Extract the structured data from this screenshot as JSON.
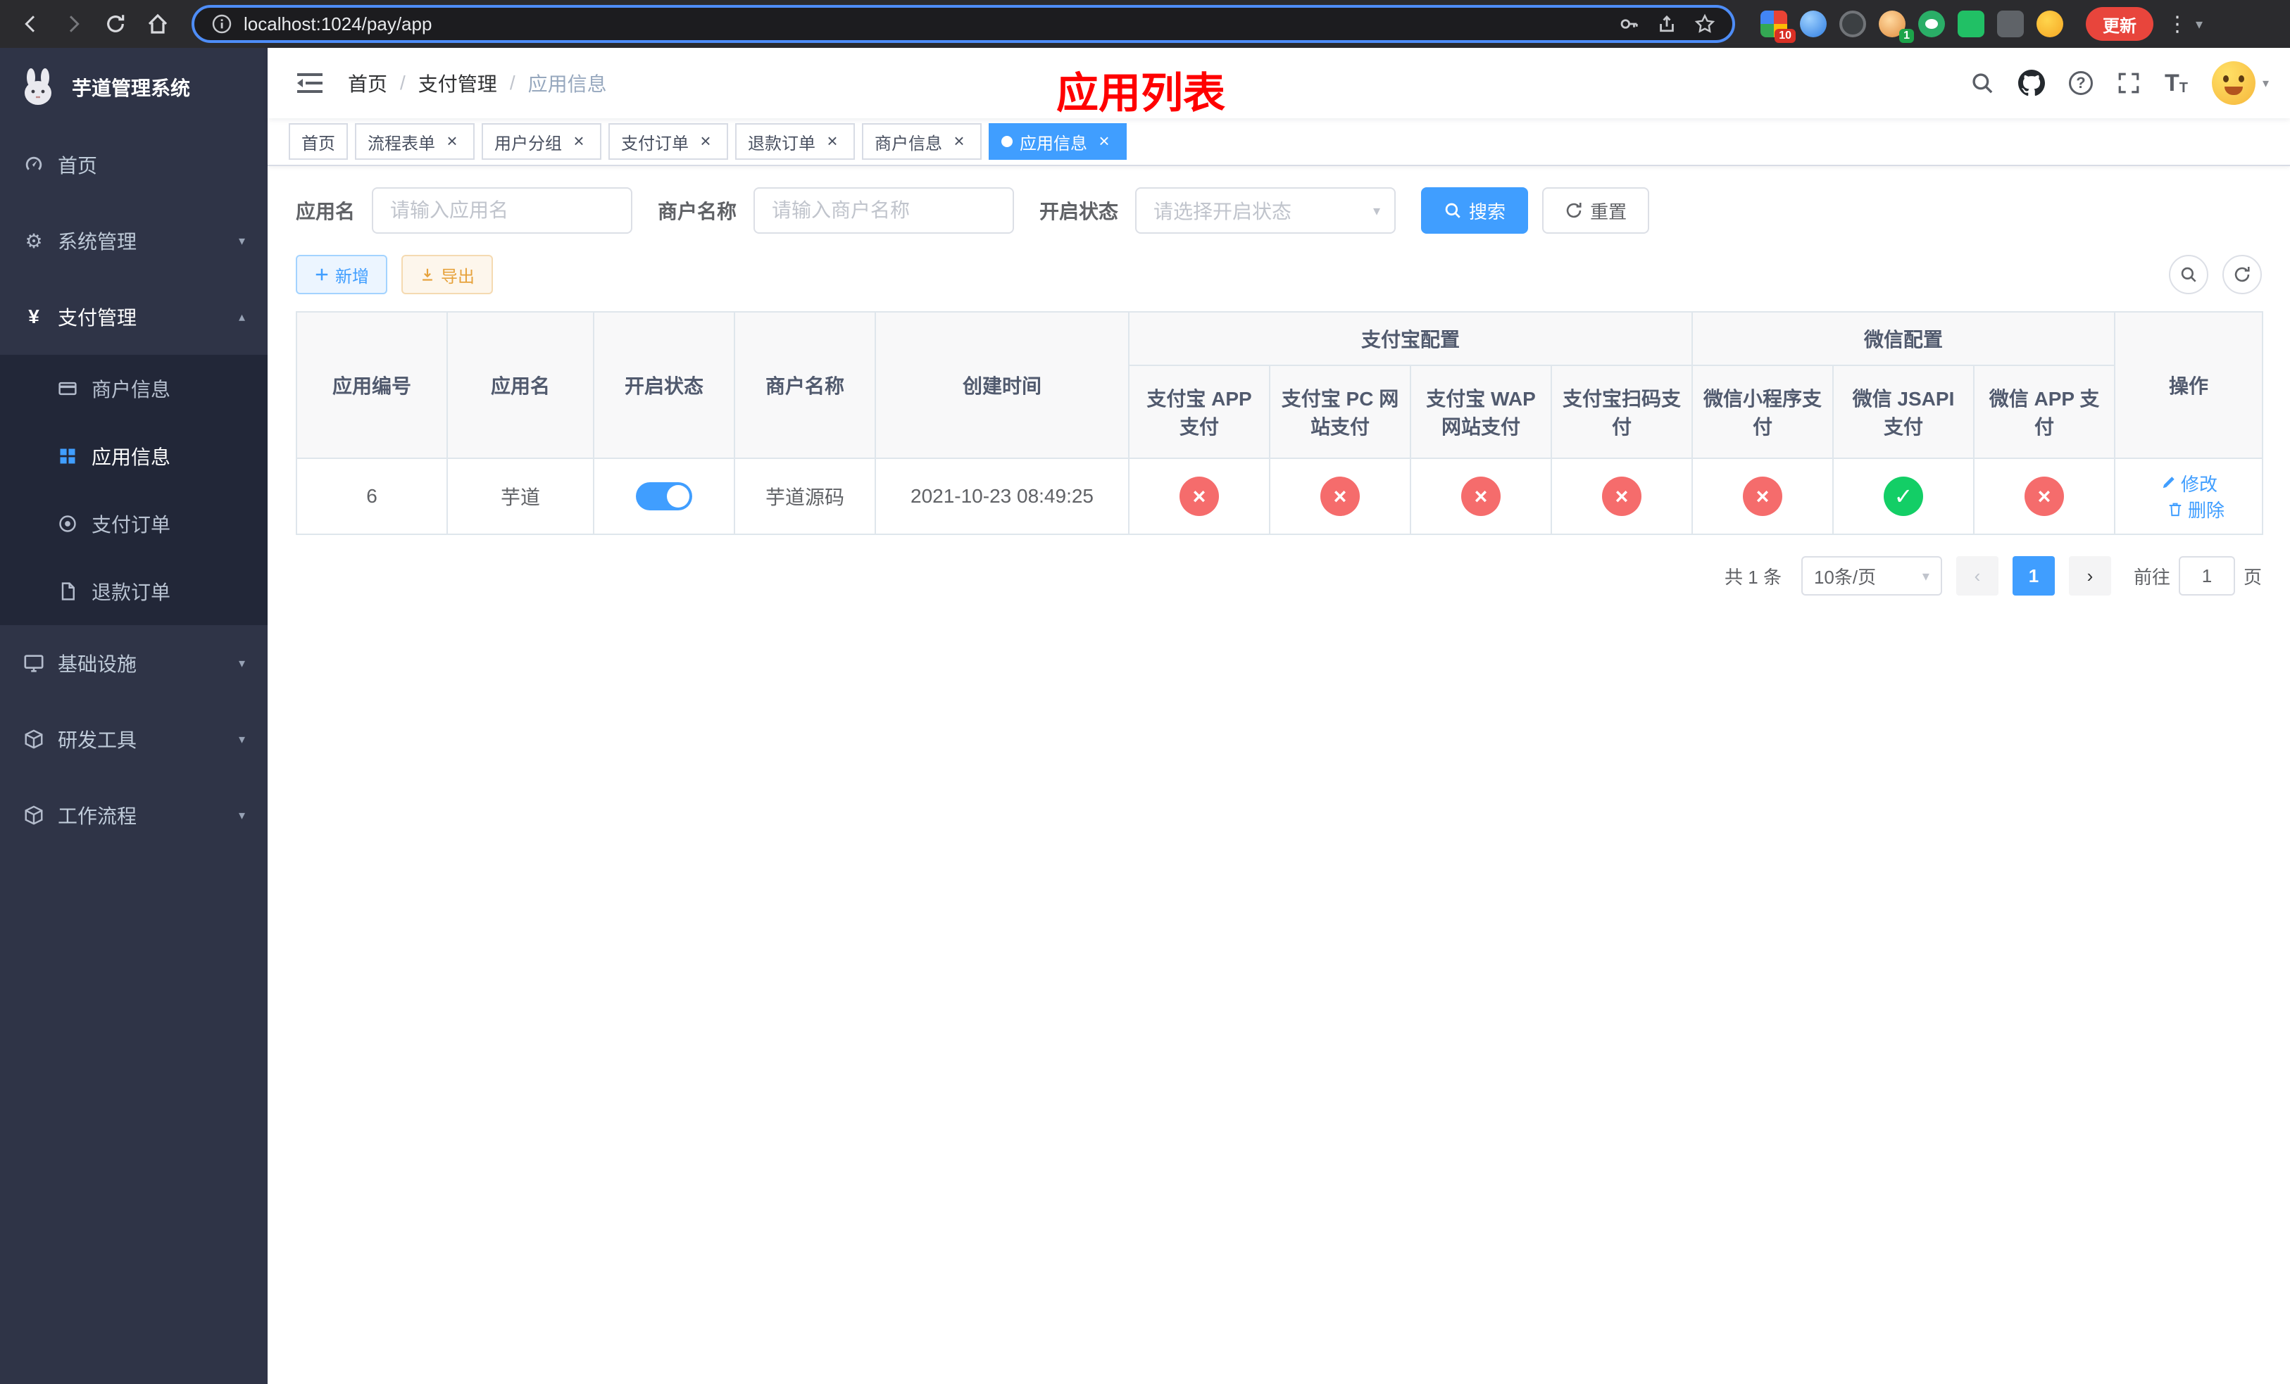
{
  "browser": {
    "url": "localhost:1024/pay/app",
    "update_label": "更新",
    "ext_badge_grid": "10",
    "ext_badge_avatar": "1"
  },
  "sidebar": {
    "title": "芋道管理系统",
    "menu": [
      {
        "label": "首页"
      },
      {
        "label": "系统管理"
      },
      {
        "label": "支付管理"
      },
      {
        "label": "基础设施"
      },
      {
        "label": "研发工具"
      },
      {
        "label": "工作流程"
      }
    ],
    "submenu": [
      {
        "label": "商户信息"
      },
      {
        "label": "应用信息"
      },
      {
        "label": "支付订单"
      },
      {
        "label": "退款订单"
      }
    ]
  },
  "header": {
    "breadcrumb": [
      "首页",
      "支付管理",
      "应用信息"
    ],
    "page_title": "应用列表"
  },
  "tabs": [
    {
      "label": "首页",
      "closable": false,
      "active": false
    },
    {
      "label": "流程表单",
      "closable": true,
      "active": false
    },
    {
      "label": "用户分组",
      "closable": true,
      "active": false
    },
    {
      "label": "支付订单",
      "closable": true,
      "active": false
    },
    {
      "label": "退款订单",
      "closable": true,
      "active": false
    },
    {
      "label": "商户信息",
      "closable": true,
      "active": false
    },
    {
      "label": "应用信息",
      "closable": true,
      "active": true
    }
  ],
  "filters": {
    "app_name_label": "应用名",
    "app_name_placeholder": "请输入应用名",
    "merchant_label": "商户名称",
    "merchant_placeholder": "请输入商户名称",
    "status_label": "开启状态",
    "status_placeholder": "请选择开启状态",
    "search_label": "搜索",
    "reset_label": "重置"
  },
  "toolbar": {
    "add_label": "新增",
    "export_label": "导出"
  },
  "table": {
    "headers": {
      "app_id": "应用编号",
      "app_name": "应用名",
      "status": "开启状态",
      "merchant": "商户名称",
      "create_time": "创建时间",
      "alipay_group": "支付宝配置",
      "wechat_group": "微信配置",
      "actions": "操作",
      "alipay_app": "支付宝 APP 支付",
      "alipay_pc": "支付宝 PC 网站支付",
      "alipay_wap": "支付宝 WAP 网站支付",
      "alipay_qr": "支付宝扫码支付",
      "wx_mini": "微信小程序支付",
      "wx_jsapi": "微信 JSAPI 支付",
      "wx_app": "微信 APP 支付"
    },
    "rows": [
      {
        "app_id": "6",
        "app_name": "芋道",
        "status": "on",
        "merchant": "芋道源码",
        "create_time": "2021-10-23 08:49:25",
        "alipay_app": "disabled",
        "alipay_pc": "disabled",
        "alipay_wap": "disabled",
        "alipay_qr": "disabled",
        "wx_mini": "disabled",
        "wx_jsapi": "enabled",
        "wx_app": "disabled",
        "edit_label": "修改",
        "delete_label": "删除"
      }
    ]
  },
  "pagination": {
    "total_text": "共 1 条",
    "page_size": "10条/页",
    "current_page": "1",
    "goto_label": "前往",
    "goto_value": "1",
    "page_unit": "页"
  },
  "colors": {
    "primary": "#409eff",
    "danger": "#f56c6c",
    "success": "#13ce66",
    "warning": "#e6a23c",
    "title_red": "#ff0000",
    "sidebar_bg": "#2f3447",
    "chrome_bg": "#2b2b2e",
    "update_red": "#e8453c"
  }
}
